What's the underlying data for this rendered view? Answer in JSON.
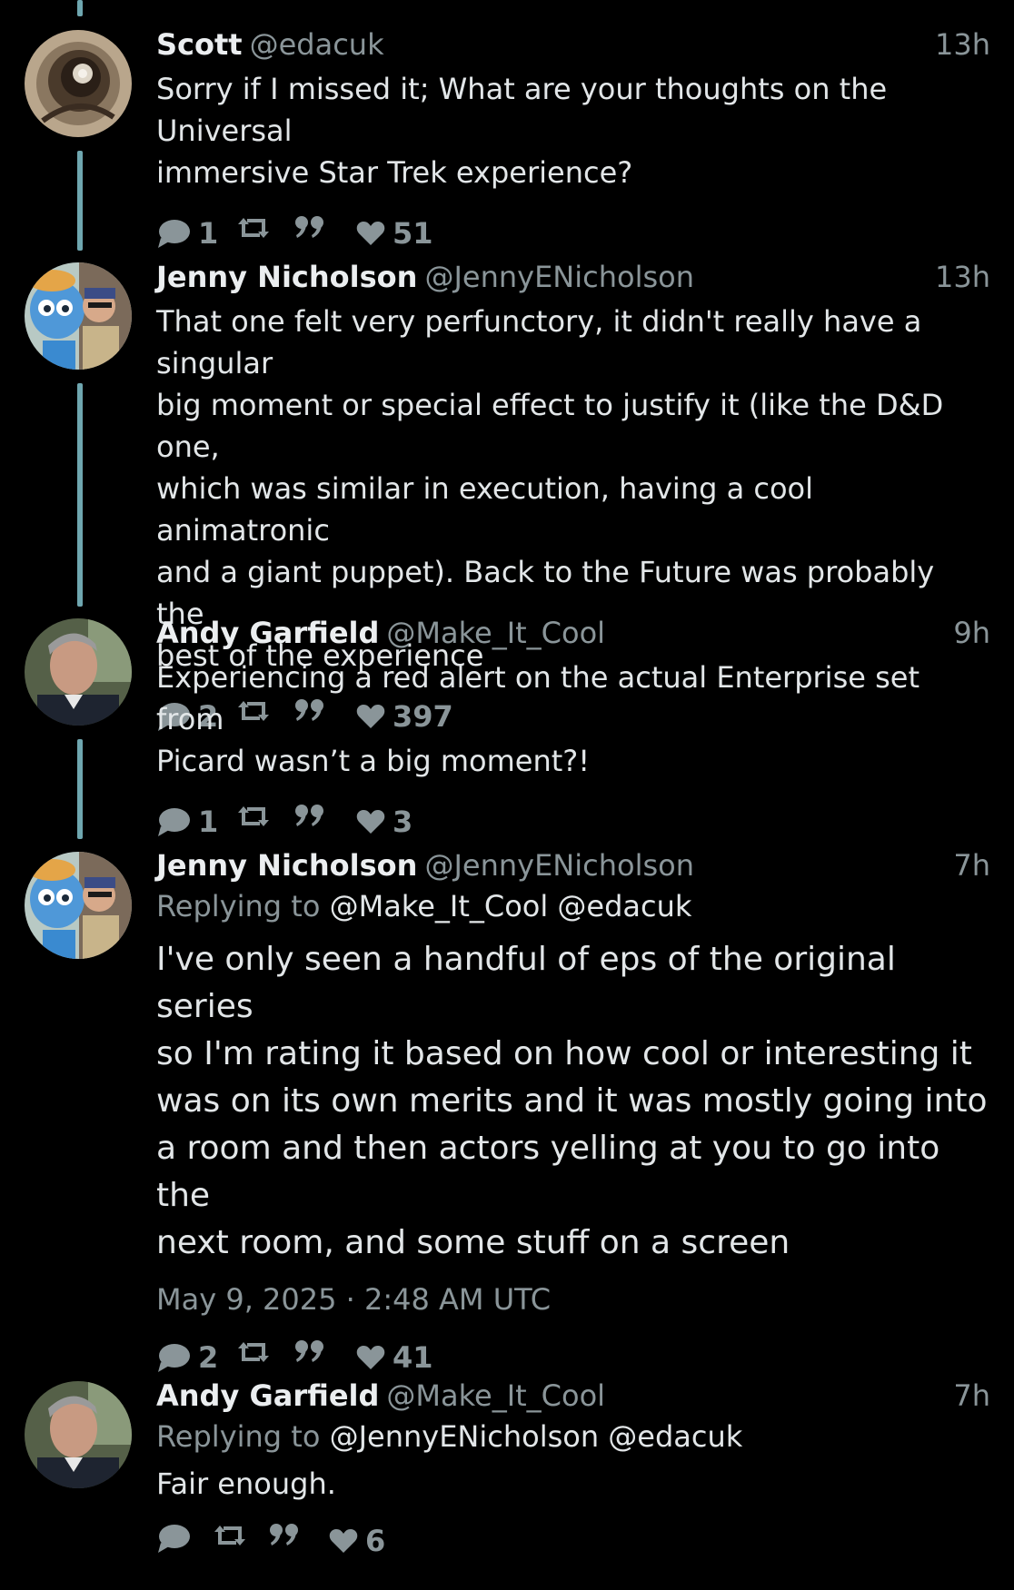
{
  "tweets": [
    {
      "name": "Scott",
      "handle": "@edacuk",
      "time": "13h",
      "text_lines": [
        "Sorry if I missed it; What are your thoughts on the Universal",
        "immersive Star Trek experience?"
      ],
      "replies": "1",
      "likes": "51"
    },
    {
      "name": "Jenny Nicholson",
      "handle": "@JennyENicholson",
      "time": "13h",
      "text_lines": [
        "That one felt very perfunctory, it didn't really have a singular",
        "big moment or special effect to justify it (like the D&D one,",
        "which was similar in execution, having a cool animatronic",
        "and a giant puppet). Back to the Future was probably the",
        "best of the experience"
      ],
      "replies": "2",
      "likes": "397"
    },
    {
      "name": "Andy Garfield",
      "handle": "@Make_It_Cool",
      "time": "9h",
      "text_lines": [
        "Experiencing a red alert on the actual Enterprise set from",
        "Picard wasn’t a big moment?!"
      ],
      "replies": "1",
      "likes": "3"
    },
    {
      "name": "Jenny Nicholson",
      "handle": "@JennyENicholson",
      "time": "7h",
      "replying_label": "Replying to",
      "replying_mentions": "@Make_It_Cool @edacuk",
      "text_lines": [
        "I've only seen a handful of eps of the original series",
        "so I'm rating it based on how cool or interesting it",
        "was on its own merits and it was mostly going into",
        "a room and then actors yelling at you to go into the",
        "next room, and some stuff on a screen"
      ],
      "date": "May 9, 2025 · 2:48 AM UTC",
      "replies": "2",
      "likes": "41"
    },
    {
      "name": "Andy Garfield",
      "handle": "@Make_It_Cool",
      "time": "7h",
      "replying_label": "Replying to",
      "replying_mentions": "@JennyENicholson @edacuk",
      "text_lines": [
        "Fair enough."
      ],
      "replies": "",
      "likes": "6"
    }
  ],
  "icons": {
    "reply": "speech-bubble-icon",
    "retweet": "retweet-icon",
    "quote": "quote-icon",
    "like": "heart-icon"
  },
  "colors": {
    "background": "#000000",
    "thread_line": "#6fa7b0",
    "muted_text": "#8a9599",
    "text": "#e2e6e8"
  }
}
